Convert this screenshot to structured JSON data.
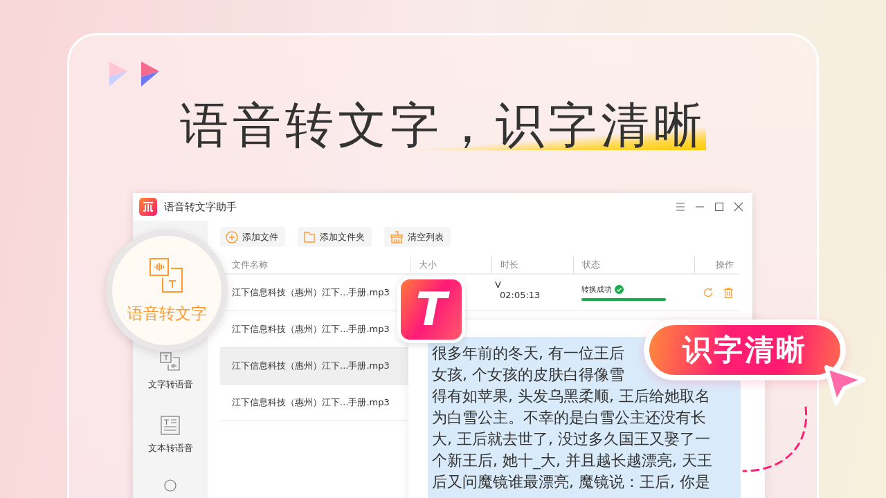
{
  "headline": "语音转文字，识字清晰",
  "window": {
    "title": "语音转文字助手"
  },
  "sidebar": {
    "items": [
      {
        "label": "语音转文字",
        "selected": true
      },
      {
        "label": "文字转语音",
        "selected": false
      },
      {
        "label": "文本转语音",
        "selected": false
      }
    ]
  },
  "toolbar": [
    "添加文件",
    "添加文件夹",
    "清空列表"
  ],
  "table": {
    "columns": [
      "文件名称",
      "大小",
      "时长",
      "状态",
      "操作"
    ],
    "rows": [
      {
        "name": "江下信息科技（惠州）江下...手册.mp3",
        "duration_note": "V",
        "duration": "02:05:13",
        "status": "转换成功",
        "level": 1,
        "selected": false
      },
      {
        "name": "江下信息科技（惠州）江下...手册.mp3",
        "selected": false
      },
      {
        "name": "江下信息科技（惠州）江下...手册.mp3",
        "selected": true
      },
      {
        "name": "江下信息科技（惠州）江下...手册.mp3",
        "selected": false
      }
    ]
  },
  "app_badge": "T",
  "result_text": [
    "很多年前的冬天, 有一位王后",
    "女孩, 个女孩的皮肤白得像雪",
    "得有如苹果, 头发乌黑柔顺, 王后给她取名",
    "为白雪公主。不幸的是白雪公主还没有长",
    "大, 王后就去世了, 没过多久国王又娶了一",
    "个新王后, 她十_大, 并且越长越漂亮, 天王",
    "后又问魔镜谁最漂亮, 魔镜说：王后, 你是"
  ],
  "callout": "识字清晰"
}
